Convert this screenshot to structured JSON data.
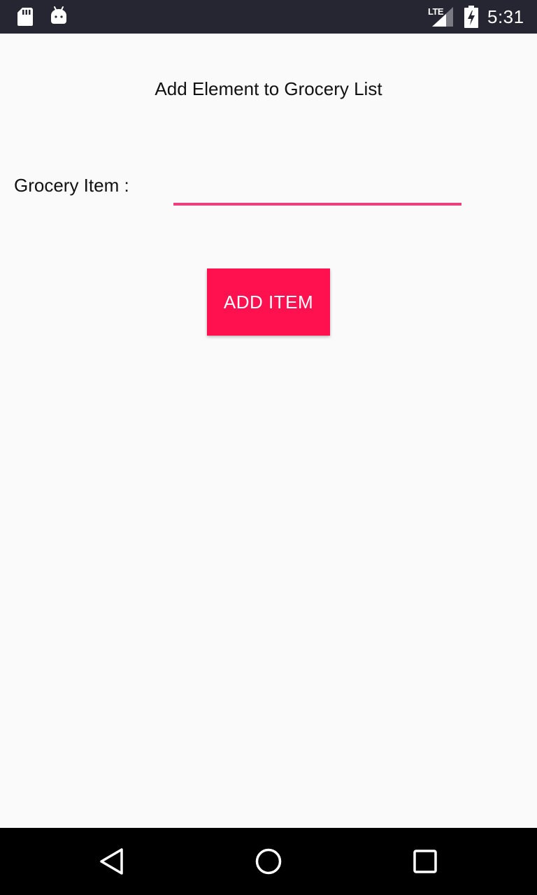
{
  "status_bar": {
    "icons": [
      "sd-card-icon",
      "android-debug-icon",
      "signal-icon",
      "battery-charging-icon"
    ],
    "network": "LTE",
    "time": "5:31"
  },
  "main": {
    "title": "Add Element to Grocery List",
    "field_label": "Grocery Item :",
    "input_value": "",
    "input_placeholder": "",
    "button_label": "ADD ITEM"
  },
  "nav_bar": {
    "icons": [
      "back-icon",
      "home-icon",
      "recents-icon"
    ]
  },
  "colors": {
    "status_bar_bg": "#252631",
    "accent": "#ff1150",
    "input_underline": "#ee3e7e",
    "background": "#fafafa",
    "nav_bar_bg": "#000000"
  }
}
